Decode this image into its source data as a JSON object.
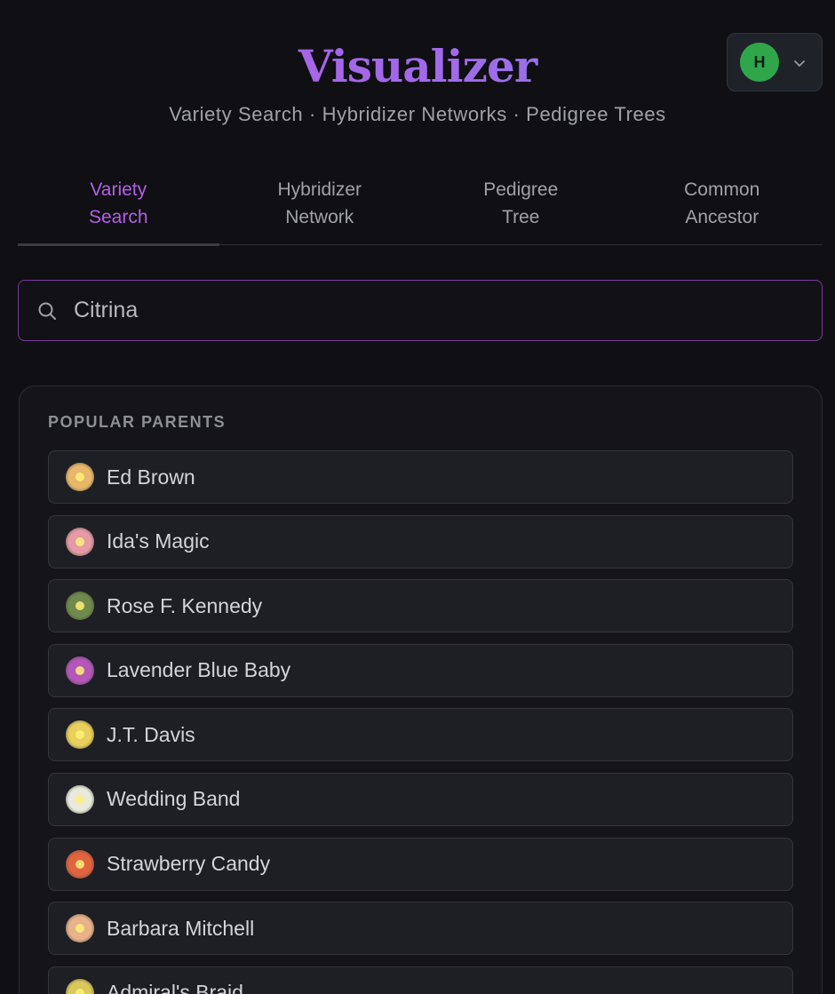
{
  "header": {
    "title": "Visualizer",
    "subtitle": "Variety Search · Hybridizer Networks · Pedigree Trees",
    "user_initial": "H"
  },
  "tabs": [
    {
      "line1": "Variety",
      "line2": "Search",
      "active": true
    },
    {
      "line1": "Hybridizer",
      "line2": "Network",
      "active": false
    },
    {
      "line1": "Pedigree",
      "line2": "Tree",
      "active": false
    },
    {
      "line1": "Common",
      "line2": "Ancestor",
      "active": false
    }
  ],
  "search": {
    "placeholder": "Citrina",
    "value": ""
  },
  "popular_parents": {
    "title": "POPULAR PARENTS",
    "items": [
      {
        "label": "Ed Brown",
        "color": "#e8b86a"
      },
      {
        "label": "Ida's Magic",
        "color": "#e59aa6"
      },
      {
        "label": "Rose F. Kennedy",
        "color": "#6f8a4a"
      },
      {
        "label": "Lavender Blue Baby",
        "color": "#b457b8"
      },
      {
        "label": "J.T. Davis",
        "color": "#e9cf5c"
      },
      {
        "label": "Wedding Band",
        "color": "#e8eadc"
      },
      {
        "label": "Strawberry Candy",
        "color": "#e0643f"
      },
      {
        "label": "Barbara Mitchell",
        "color": "#e9b38a"
      },
      {
        "label": "Admiral's Braid",
        "color": "#d8c95a"
      }
    ]
  },
  "colors": {
    "accent": "#b55fe6",
    "avatar": "#2fa64a",
    "background": "#0f0f14"
  }
}
